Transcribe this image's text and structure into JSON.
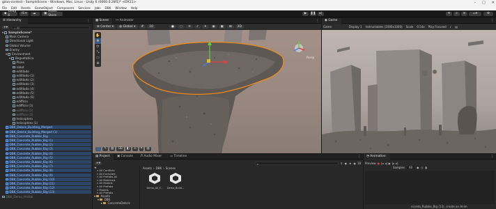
{
  "titlebar": {
    "title": "gilon-contest - SampleScene - Windows, Mac, Linux - Unity 6 (6000.0.28f1)* <DX11>"
  },
  "menubar": {
    "items": [
      "File",
      "Edit",
      "Assets",
      "GameObject",
      "Component",
      "Services",
      "Jobs",
      "DBK",
      "Window",
      "Help"
    ]
  },
  "toolbar": {
    "account": "Unity 6",
    "account_badge": "IS",
    "asset_store": "Asset Store"
  },
  "hierarchy": {
    "tab": "Hierarchy",
    "search_placeholder": "All",
    "items": [
      {
        "label": "SampleScene*",
        "depth": 0,
        "kind": "scene"
      },
      {
        "label": "Main Camera",
        "depth": 1,
        "kind": "go"
      },
      {
        "label": "Directional Light",
        "depth": 1,
        "kind": "go"
      },
      {
        "label": "Global Volume",
        "depth": 1,
        "kind": "go"
      },
      {
        "label": "Enemy",
        "depth": 1,
        "kind": "go"
      },
      {
        "label": "Environment",
        "depth": 1,
        "kind": "go"
      },
      {
        "label": "Beguetatlica",
        "depth": 2,
        "kind": "go"
      },
      {
        "label": "Plane",
        "depth": 3,
        "kind": "go"
      },
      {
        "label": "robot",
        "depth": 3,
        "kind": "go"
      },
      {
        "label": "edifdado",
        "depth": 3,
        "kind": "go"
      },
      {
        "label": "edifdado (1)",
        "depth": 3,
        "kind": "go"
      },
      {
        "label": "edifdado (2)",
        "depth": 3,
        "kind": "go"
      },
      {
        "label": "edifdado (3)",
        "depth": 3,
        "kind": "go"
      },
      {
        "label": "edifdado (4)",
        "depth": 3,
        "kind": "go"
      },
      {
        "label": "edifdado (5)",
        "depth": 3,
        "kind": "go"
      },
      {
        "label": "edifdado (6)",
        "depth": 3,
        "kind": "go"
      },
      {
        "label": "edifficio",
        "depth": 3,
        "kind": "go"
      },
      {
        "label": "edifficio (1)",
        "depth": 3,
        "kind": "go"
      },
      {
        "label": "edifficio (2)",
        "depth": 3,
        "kind": "dim"
      },
      {
        "label": "edifficio (3)",
        "depth": 3,
        "kind": "dim"
      },
      {
        "label": "helicoptero",
        "depth": 3,
        "kind": "go"
      },
      {
        "label": "helicoptero (1)",
        "depth": 3,
        "kind": "go"
      },
      {
        "label": "DBK_Debris_Building_Merged",
        "depth": 1,
        "kind": "sel"
      },
      {
        "label": "DBK_Debris_Building_Merged (1)",
        "depth": 1,
        "kind": "sel"
      },
      {
        "label": "DBK_Concrete_Rubble_Big",
        "depth": 1,
        "kind": "sel"
      },
      {
        "label": "DBK_Concrete_Rubble_Big (1)",
        "depth": 1,
        "kind": "sel"
      },
      {
        "label": "DBK_Concrete_Rubble_Big (2)",
        "depth": 1,
        "kind": "sel"
      },
      {
        "label": "DBK_Concrete_Rubble_Big (3)",
        "depth": 1,
        "kind": "sel"
      },
      {
        "label": "DBK_Concrete_Rubble_Big (4)",
        "depth": 1,
        "kind": "sel"
      },
      {
        "label": "DBK_Concrete_Rubble_Big (5)",
        "depth": 1,
        "kind": "sel"
      },
      {
        "label": "DBK_Concrete_Rubble_Big (6)",
        "depth": 1,
        "kind": "sel"
      },
      {
        "label": "DBK_Concrete_Rubble_Big (7)",
        "depth": 1,
        "kind": "sel"
      },
      {
        "label": "DBK_Concrete_Rubble_Big (8)",
        "depth": 1,
        "kind": "sel"
      },
      {
        "label": "DBK_Concrete_Rubble_Big (9)",
        "depth": 1,
        "kind": "sel"
      },
      {
        "label": "DBK_Concrete_Rubble_Big (10)",
        "depth": 1,
        "kind": "sel"
      },
      {
        "label": "DBK_Concrete_Rubble_Big (11)",
        "depth": 1,
        "kind": "sel"
      },
      {
        "label": "DBK_Concrete_Rubble_Big (12)",
        "depth": 1,
        "kind": "sel"
      },
      {
        "label": "DBK_Concrete_Rubble_Big (13)",
        "depth": 1,
        "kind": "sel"
      },
      {
        "label": "DBK_Demo_Prefab",
        "depth": 0,
        "kind": "dim"
      }
    ]
  },
  "scene": {
    "tabs": [
      "Scene",
      "Animator"
    ],
    "pivot": "Center",
    "space": "Global",
    "snap": "10",
    "persp": "Persp"
  },
  "game": {
    "tab": "Game",
    "display": "Game",
    "display_num": "Display 1",
    "resolution": "Instructables (1000x1000)",
    "scale": "Scale",
    "scale_value": "0.54x",
    "play_mode": "Play Focused"
  },
  "project": {
    "tabs": [
      "Project",
      "Console",
      "Audio Mixer",
      "Timeline"
    ],
    "favorites": [
      "All Conflicts",
      "All Excluded",
      "All Prefabs All",
      "All Materials",
      "All Models",
      "All Prefabs",
      "Models",
      "All Prefabs"
    ],
    "favorites_root": "Assets",
    "tree": [
      "Assets",
      "DBK",
      "ConcreteDebris"
    ],
    "breadcrumb": [
      "Assets",
      "DBK",
      "Scenes"
    ],
    "assets": [
      {
        "name": "Demo_All_F..."
      },
      {
        "name": "Demo_Build..."
      }
    ],
    "count": "18"
  },
  "animation": {
    "tab": "Animation",
    "preview_label": "Preview",
    "samples_label": "Samples",
    "samples_value": "60",
    "status": "nicreta_Rubble_Big (13), create an Anim"
  }
}
